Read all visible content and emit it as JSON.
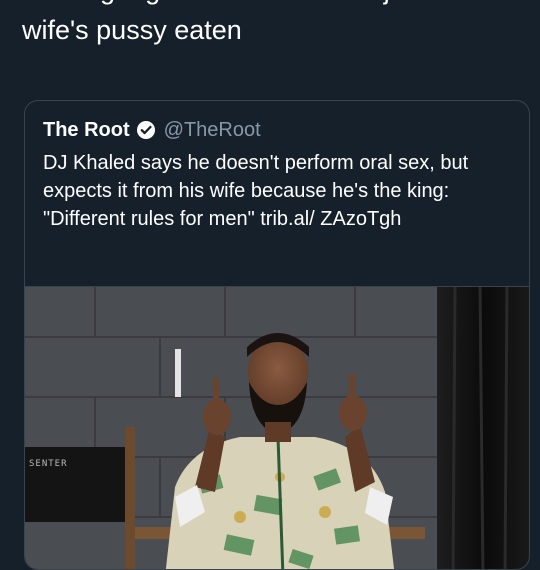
{
  "tweet": {
    "text": "Starting a gofundme to have dj khaled's wife's pussy eaten"
  },
  "quoted_tweet": {
    "display_name": "The Root",
    "handle": "@TheRoot",
    "verified": true,
    "text": "DJ Khaled says he doesn't perform oral sex, but expects it from his wife because he's the king: \"Different rules for men\" trib.al/ ZAzoTgh",
    "photo": {
      "chair_label": "SENTER"
    }
  },
  "colors": {
    "background": "#15202b",
    "border": "#38444d",
    "secondary_text": "#8899a6",
    "verified_badge": "#ffffff"
  }
}
